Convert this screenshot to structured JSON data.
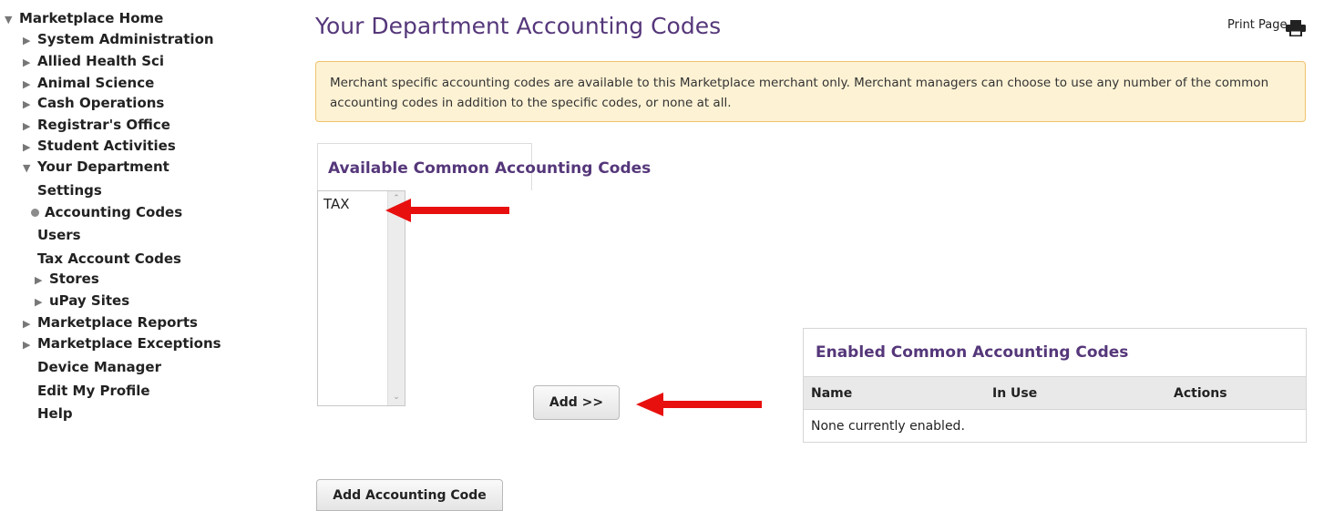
{
  "sidebar": {
    "items": [
      {
        "label": "Marketplace Home",
        "marker": "triangle-down"
      },
      {
        "label": "System Administration",
        "marker": "triangle-right"
      },
      {
        "label": "Allied Health Sci",
        "marker": "triangle-right"
      },
      {
        "label": "Animal Science",
        "marker": "triangle-right"
      },
      {
        "label": "Cash Operations",
        "marker": "triangle-right"
      },
      {
        "label": "Registrar's Office",
        "marker": "triangle-right"
      },
      {
        "label": "Student Activities",
        "marker": "triangle-right"
      },
      {
        "label": "Your Department",
        "marker": "triangle-down"
      },
      {
        "label": "Settings",
        "marker": "none"
      },
      {
        "label": "Accounting Codes",
        "marker": "dot"
      },
      {
        "label": "Users",
        "marker": "none"
      },
      {
        "label": "Tax Account Codes",
        "marker": "none"
      },
      {
        "label": "Stores",
        "marker": "triangle-right"
      },
      {
        "label": "uPay Sites",
        "marker": "triangle-right"
      },
      {
        "label": "Marketplace Reports",
        "marker": "triangle-right"
      },
      {
        "label": "Marketplace Exceptions",
        "marker": "triangle-right"
      },
      {
        "label": "Device Manager",
        "marker": "none"
      },
      {
        "label": "Edit My Profile",
        "marker": "none"
      },
      {
        "label": "Help",
        "marker": "none"
      }
    ]
  },
  "header": {
    "title": "Your Department Accounting Codes",
    "print_label": "Print Page",
    "print_icon": "printer-icon"
  },
  "notice": {
    "text": "Merchant specific accounting codes are available to this Marketplace merchant only. Merchant managers can choose to use any number of the common accounting codes in addition to the specific codes, or none at all."
  },
  "available": {
    "title": "Available Common Accounting Codes",
    "options": [
      "TAX"
    ]
  },
  "add_button": {
    "label": "Add >>"
  },
  "enabled": {
    "title": "Enabled Common Accounting Codes",
    "columns": [
      "Name",
      "In Use",
      "Actions"
    ],
    "empty_text": "None currently enabled."
  },
  "add_code_button": {
    "label": "Add Accounting Code"
  },
  "colors": {
    "heading": "#55377a",
    "notice_bg": "#fdf2d4",
    "notice_border": "#f0c36d",
    "annotation_arrow": "#e8100f"
  }
}
